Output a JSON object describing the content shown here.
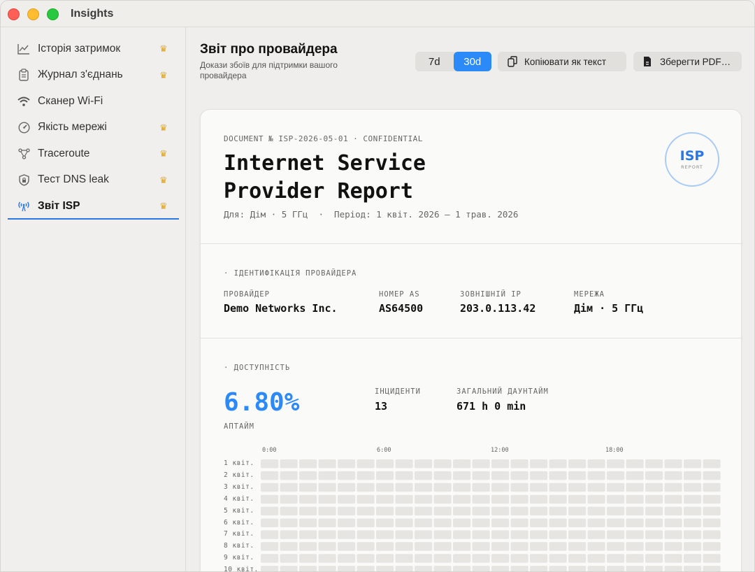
{
  "window": {
    "app_title": "Insights"
  },
  "sidebar": {
    "items": [
      {
        "label": "Історія затримок",
        "icon": "chart-line-icon",
        "premium": true
      },
      {
        "label": "Журнал з'єднань",
        "icon": "clipboard-icon",
        "premium": true
      },
      {
        "label": "Сканер Wi-Fi",
        "icon": "wifi-icon",
        "premium": false
      },
      {
        "label": "Якість мережі",
        "icon": "gauge-icon",
        "premium": true
      },
      {
        "label": "Traceroute",
        "icon": "network-nodes-icon",
        "premium": true
      },
      {
        "label": "Тест DNS leak",
        "icon": "shield-lock-icon",
        "premium": true
      },
      {
        "label": "Звіт ISP",
        "icon": "antenna-icon",
        "premium": true,
        "active": true
      }
    ]
  },
  "header": {
    "title": "Звіт про провайдера",
    "subtitle": "Докази збоїв для підтримки вашого провайдера",
    "period_options": [
      "7d",
      "30d"
    ],
    "period_selected": "30d",
    "copy_label": "Копіювати як текст",
    "pdf_label": "Зберегти PDF…"
  },
  "report": {
    "doc_number": "DOCUMENT № ISP-2026-05-01 · CONFIDENTIAL",
    "title_line1": "Internet Service",
    "title_line2": "Provider Report",
    "meta": "Для: Дім · 5 ГГц  ·  Період: 1 квіт. 2026 — 1 трав. 2026",
    "stamp_main": "ISP",
    "stamp_sub": "REPORT",
    "identification": {
      "section_label": "· ІДЕНТИФІКАЦІЯ ПРОВАЙДЕРА",
      "provider_label": "ПРОВАЙДЕР",
      "provider_value": "Demo Networks Inc.",
      "as_label": "НОМЕР AS",
      "as_value": "AS64500",
      "ip_label": "ЗОВНІШНІЙ IP",
      "ip_value": "203.0.113.42",
      "network_label": "МЕРЕЖА",
      "network_value": "Дім · 5 ГГц"
    },
    "availability": {
      "section_label": "· ДОСТУПНІСТЬ",
      "uptime_value": "6.80%",
      "uptime_label": "АПТАЙМ",
      "incidents_label": "ІНЦИДЕНТИ",
      "incidents_value": "13",
      "downtime_label": "ЗАГАЛЬНИЙ ДАУНТАЙМ",
      "downtime_value": "671 h 0 min"
    },
    "heatmap": {
      "hour_labels": [
        "0:00",
        "6:00",
        "12:00",
        "18:00"
      ],
      "day_labels": [
        "1 квіт.",
        "2 квіт.",
        "3 квіт.",
        "4 квіт.",
        "5 квіт.",
        "6 квіт.",
        "7 квіт.",
        "8 квіт.",
        "9 квіт.",
        "10 квіт."
      ]
    }
  },
  "colors": {
    "accent": "#2b8af7",
    "premium_crown": "#e0a51a",
    "heatmap_cell": "#e6e5e2"
  }
}
